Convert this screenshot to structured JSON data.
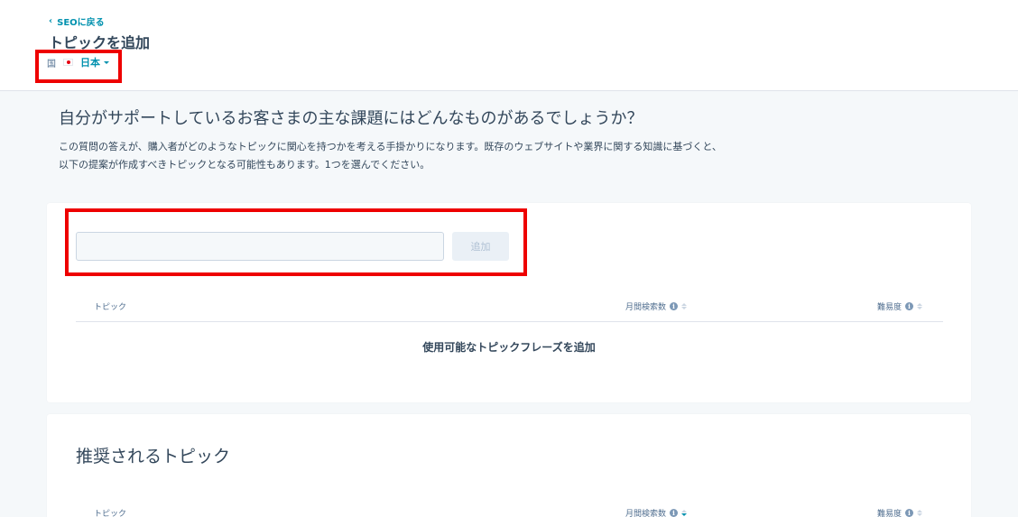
{
  "header": {
    "back_label": "SEOに戻る",
    "title": "トピックを追加",
    "country_label": "国",
    "country_value": "日本"
  },
  "intro": {
    "question": "自分がサポートしているお客さまの主な課題にはどんなものがあるでしょうか？",
    "description": "この質問の答えが、購入者がどのようなトピックに関心を持つかを考える手掛かりになります。既存のウェブサイトや業界に関する知識に基づくと、以下の提案が作成すべきトピックとなる可能性もあります。1つを選んでください。"
  },
  "add_form": {
    "input_value": "",
    "button_label": "追加"
  },
  "table": {
    "columns": [
      "トピック",
      "月間検索数",
      "難易度"
    ],
    "empty_message": "使用可能なトピックフレーズを追加"
  },
  "recommended": {
    "title": "推奨されるトピック",
    "columns": [
      "トピック",
      "月間検索数",
      "難易度"
    ]
  },
  "colors": {
    "accent": "#0091ae",
    "highlight": "#ee0000",
    "text": "#33475b"
  }
}
